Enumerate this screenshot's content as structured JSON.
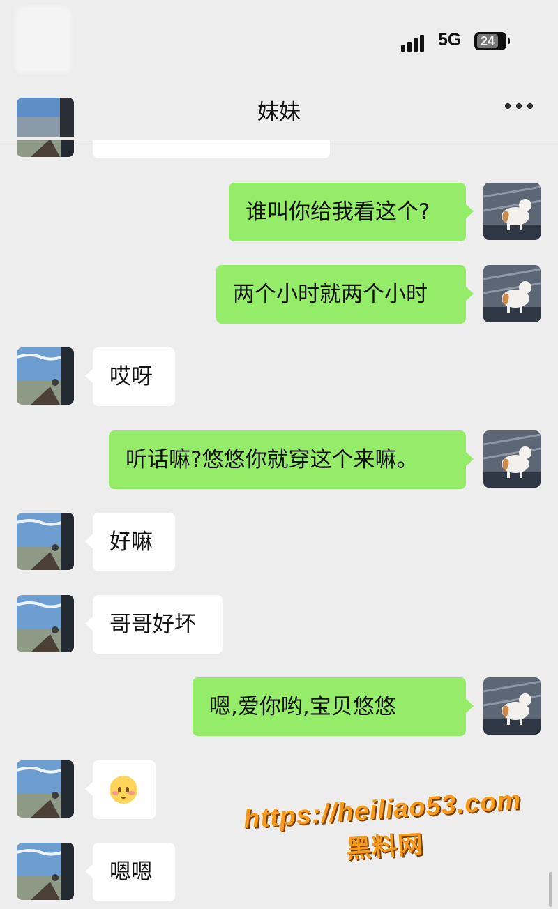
{
  "status": {
    "network": "5G",
    "battery": "24"
  },
  "header": {
    "title": "妹妹",
    "more_icon": "more-dots-icon"
  },
  "messages": [
    {
      "side": "them",
      "text": "",
      "partial": true
    },
    {
      "side": "me",
      "text": "谁叫你给我看这个?"
    },
    {
      "side": "me",
      "text": "两个小时就两个小时"
    },
    {
      "side": "them",
      "text": "哎呀"
    },
    {
      "side": "me",
      "text": "听话嘛?悠悠你就穿这个来嘛。"
    },
    {
      "side": "them",
      "text": "好嘛"
    },
    {
      "side": "them",
      "text": "哥哥好坏"
    },
    {
      "side": "me",
      "text": "嗯,爱你哟,宝贝悠悠"
    },
    {
      "side": "them",
      "text": "",
      "emoji": "smiling-face-emoji"
    },
    {
      "side": "them",
      "text": "嗯嗯"
    }
  ],
  "watermark": {
    "url": "https://heiliao53.com",
    "name": "黑料网"
  },
  "colors": {
    "background": "#ededed",
    "me_bubble": "#95ec69",
    "them_bubble": "#ffffff"
  }
}
